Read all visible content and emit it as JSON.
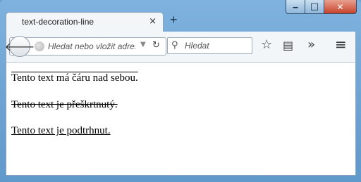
{
  "window": {
    "controls": {
      "minimize": "‒",
      "maximize": "□",
      "close": "✕"
    }
  },
  "tab": {
    "title": "text-decoration-line",
    "close": "×"
  },
  "newtab": "+",
  "toolbar": {
    "back": "🡐",
    "url_placeholder": "Hledat nebo vložit adresu",
    "url_dropdown": "▼",
    "reload": "↻",
    "search_icon": "⚲",
    "search_placeholder": "Hledat",
    "bookmark_star": "☆",
    "reader": "▤",
    "overflow": "»",
    "menu": "≡"
  },
  "content": {
    "overline_text": "Tento text má čáru nad sebou.",
    "linethrough_text": "Tento text je přeškrtnutý.",
    "underline_text": "Tento text je podtrhnut."
  }
}
